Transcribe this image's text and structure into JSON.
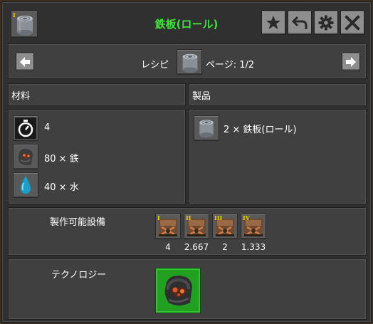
{
  "title": {
    "text": "鉄板(ロール)",
    "color": "#40e040"
  },
  "title_buttons": [
    {
      "name": "star-icon"
    },
    {
      "name": "back-arrow-icon"
    },
    {
      "name": "gear-icon"
    },
    {
      "name": "close-icon"
    }
  ],
  "recipe_nav": {
    "label": "レシピ",
    "page_text": "ページ: 1/2",
    "prev_icon": "left-arrow-icon",
    "next_icon": "right-arrow-icon"
  },
  "ingredients": {
    "header": "材料",
    "items": [
      {
        "icon": "stopwatch-icon",
        "text": "4"
      },
      {
        "icon": "iron-ore-icon",
        "text": "80 × 鉄"
      },
      {
        "icon": "water-drop-icon",
        "text": "40 × 水"
      }
    ]
  },
  "products": {
    "header": "製品",
    "items": [
      {
        "icon": "iron-plate-roll-icon",
        "text": "2 × 鉄板(ロール)"
      }
    ]
  },
  "crafters": {
    "label": "製作可能設備",
    "machines": [
      {
        "tier": "I",
        "speed": "4"
      },
      {
        "tier": "II",
        "speed": "2.667"
      },
      {
        "tier": "III",
        "speed": "2"
      },
      {
        "tier": "IV",
        "speed": "1.333"
      }
    ]
  },
  "technology": {
    "label": "テクノロジー",
    "icon": "iron-ore-tech-icon",
    "highlight_color": "#22a022"
  }
}
